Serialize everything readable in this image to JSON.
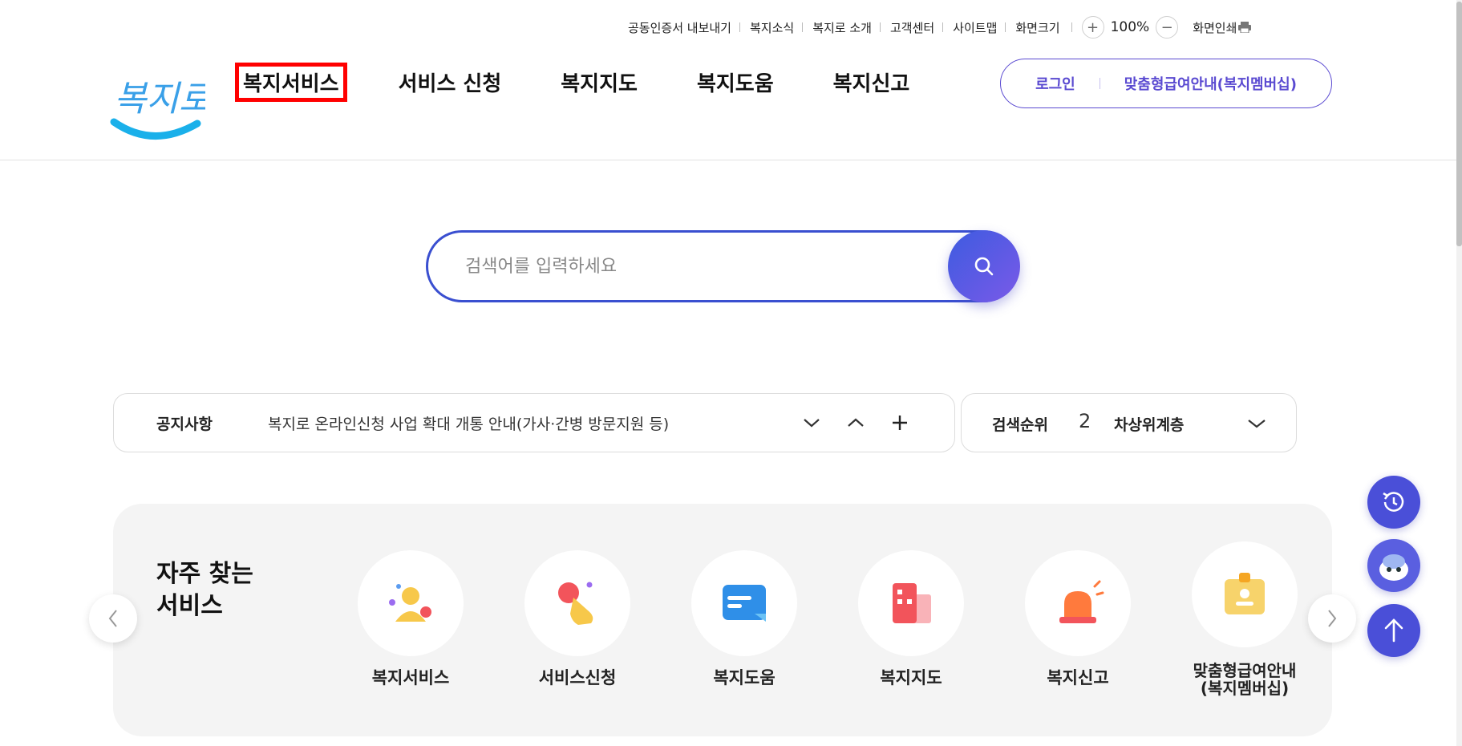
{
  "util": {
    "links": [
      "공동인증서 내보내기",
      "복지소식",
      "복지로 소개",
      "고객센터",
      "사이트맵"
    ],
    "zoom_label": "화면크기",
    "zoom_plus": "+",
    "zoom_value": "100%",
    "zoom_minus": "−",
    "print_label": "화면인쇄"
  },
  "header": {
    "logo_text": "복지로",
    "nav": [
      "복지서비스",
      "서비스 신청",
      "복지지도",
      "복지도움",
      "복지신고"
    ],
    "login": "로그인",
    "membership": "맞춤형급여안내(복지멤버십)"
  },
  "search": {
    "placeholder": "검색어를 입력하세요"
  },
  "notice": {
    "label": "공지사항",
    "text": "복지로 온라인신청 사업 확대 개통 안내(가사·간병 방문지원 등)"
  },
  "rank": {
    "label": "검색순위",
    "number": "2",
    "word": "차상위계층"
  },
  "frequent": {
    "title_line1": "자주 찾는",
    "title_line2": "서비스",
    "items": [
      {
        "label": "복지서비스"
      },
      {
        "label": "서비스신청"
      },
      {
        "label": "복지도움"
      },
      {
        "label": "복지지도"
      },
      {
        "label": "복지신고"
      },
      {
        "label": "맞춤형급여안내",
        "label2": "(복지멤버십)"
      }
    ]
  },
  "colors": {
    "brand_purple": "#5a4ad1",
    "search_blue": "#3a4fd0",
    "highlight_red": "#ff0000",
    "float_blue": "#4a4fd8"
  }
}
